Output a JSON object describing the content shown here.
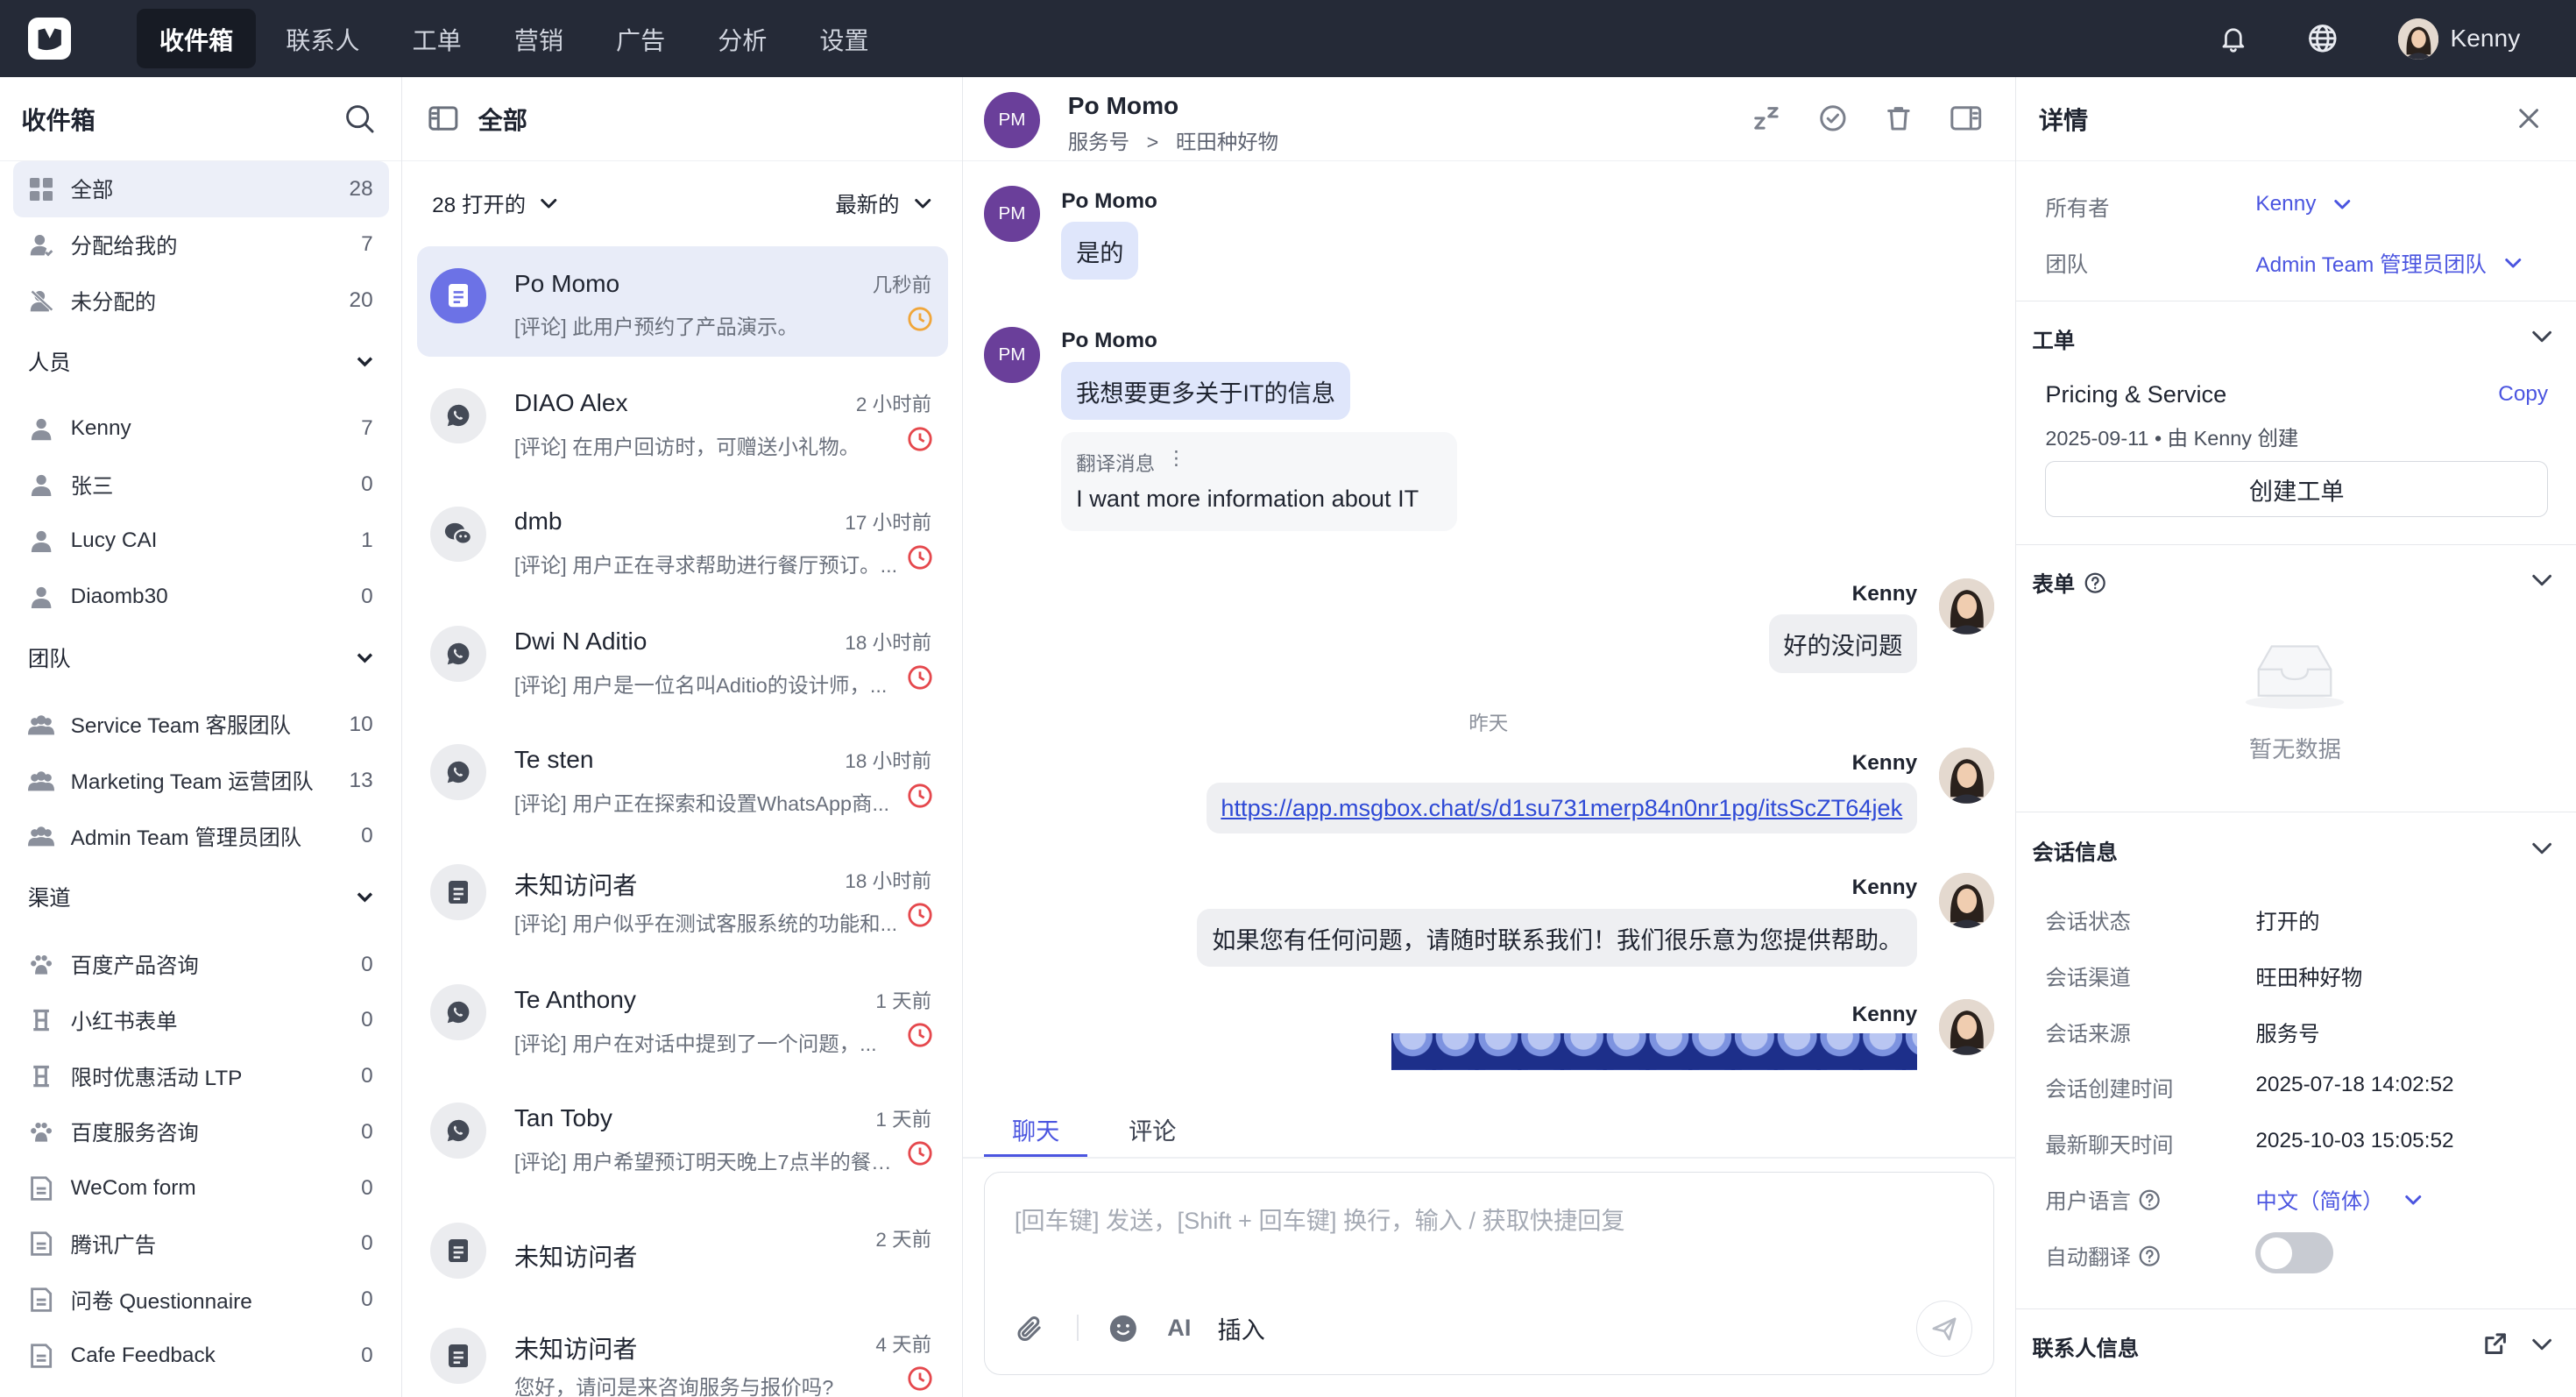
{
  "topnav": {
    "items": [
      "收件箱",
      "联系人",
      "工单",
      "营销",
      "广告",
      "分析",
      "设置"
    ],
    "user_name": "Kenny"
  },
  "sidebar": {
    "title": "收件箱",
    "inbox": [
      {
        "label": "全部",
        "count": "28"
      },
      {
        "label": "分配给我的",
        "count": "7"
      },
      {
        "label": "未分配的",
        "count": "20"
      }
    ],
    "people_title": "人员",
    "people": [
      {
        "label": "Kenny",
        "count": "7"
      },
      {
        "label": "张三",
        "count": "0"
      },
      {
        "label": "Lucy CAI",
        "count": "1"
      },
      {
        "label": "Diaomb30",
        "count": "0"
      }
    ],
    "teams_title": "团队",
    "teams": [
      {
        "label": "Service Team 客服团队",
        "count": "10"
      },
      {
        "label": "Marketing Team 运营团队",
        "count": "13"
      },
      {
        "label": "Admin Team 管理员团队",
        "count": "0"
      }
    ],
    "channels_title": "渠道",
    "channels": [
      {
        "label": "百度产品咨询",
        "count": "0",
        "icon": "baidu-icon"
      },
      {
        "label": "小红书表单",
        "count": "0",
        "icon": "form-icon"
      },
      {
        "label": "限时优惠活动 LTP",
        "count": "0",
        "icon": "form-icon"
      },
      {
        "label": "百度服务咨询",
        "count": "0",
        "icon": "baidu-icon"
      },
      {
        "label": "WeCom form",
        "count": "0",
        "icon": "doc-icon"
      },
      {
        "label": "腾讯广告",
        "count": "0",
        "icon": "doc-icon"
      },
      {
        "label": "问卷 Questionnaire",
        "count": "0",
        "icon": "doc-icon"
      },
      {
        "label": "Cafe Feedback",
        "count": "0",
        "icon": "doc-icon"
      }
    ]
  },
  "list": {
    "title": "全部",
    "filter_open": "28 打开的",
    "sort": "最新的",
    "conversations": [
      {
        "name": "Po Momo",
        "time": "几秒前",
        "preview": "[评论] 此用户预约了产品演示。",
        "icon": "doc-icon",
        "status": "pending"
      },
      {
        "name": "DIAO Alex",
        "time": "2 小时前",
        "preview": "[评论] 在用户回访时，可赠送小礼物。",
        "icon": "whatsapp-icon",
        "status": "overdue"
      },
      {
        "name": "dmb",
        "time": "17 小时前",
        "preview": "[评论] 用户正在寻求帮助进行餐厅预订。...",
        "icon": "wechat-icon",
        "status": "overdue"
      },
      {
        "name": "Dwi N Aditio",
        "time": "18 小时前",
        "preview": "[评论] 用户是一位名叫Aditio的设计师，...",
        "icon": "whatsapp-icon",
        "status": "overdue"
      },
      {
        "name": "Te sten",
        "time": "18 小时前",
        "preview": "[评论] 用户正在探索和设置WhatsApp商...",
        "icon": "whatsapp-icon",
        "status": "overdue"
      },
      {
        "name": "未知访问者",
        "time": "18 小时前",
        "preview": "[评论] 用户似乎在测试客服系统的功能和...",
        "icon": "doc-icon",
        "status": "overdue"
      },
      {
        "name": "Te Anthony",
        "time": "1 天前",
        "preview": "[评论] 用户在对话中提到了一个问题，...",
        "icon": "whatsapp-icon",
        "status": "overdue"
      },
      {
        "name": "Tan Toby",
        "time": "1 天前",
        "preview": "[评论] 用户希望预订明天晚上7点半的餐厅...",
        "icon": "whatsapp-icon",
        "status": "overdue"
      },
      {
        "name": "未知访问者",
        "time": "2 天前",
        "preview": "",
        "icon": "doc-icon",
        "status": "none"
      },
      {
        "name": "未知访问者",
        "time": "4 天前",
        "preview": "您好，请问是来咨询服务与报价吗?",
        "icon": "doc-icon",
        "status": "overdue"
      }
    ]
  },
  "chat": {
    "avatar_initials": "PM",
    "contact_name": "Po Momo",
    "channel_type": "服务号",
    "breadcrumb_sep": ">",
    "channel_name": "旺田种好物",
    "messages": {
      "m1_sender": "Po Momo",
      "m1_text": "是的",
      "m2_sender": "Po Momo",
      "m2_text": "我想要更多关于IT的信息",
      "translation_label": "翻译消息",
      "translation_menu": "⋮",
      "translation_text": "I want more information about IT",
      "m3_sender": "Kenny",
      "m3_text": "好的没问题",
      "day_separator": "昨天",
      "m4_sender": "Kenny",
      "m4_link": "https://app.msgbox.chat/s/d1su731merp84n0nr1pg/itsScZT64jek",
      "m5_sender": "Kenny",
      "m5_text": "如果您有任何问题，请随时联系我们！我们很乐意为您提供帮助。",
      "m6_sender": "Kenny"
    },
    "tabs": [
      "聊天",
      "评论"
    ],
    "composer_placeholder": "[回车键] 发送，[Shift + 回车键] 换行，输入 / 获取快捷回复",
    "ai_label": "AI",
    "insert_label": "插入"
  },
  "details": {
    "title": "详情",
    "owner_label": "所有者",
    "owner_value": "Kenny",
    "team_label": "团队",
    "team_value": "Admin Team 管理员团队",
    "ticket_section": "工单",
    "ticket_title": "Pricing & Service",
    "ticket_copy": "Copy",
    "ticket_meta": "2025-09-11 • 由 Kenny 创建",
    "create_ticket_button": "创建工单",
    "form_section": "表单",
    "empty_text": "暂无数据",
    "session_section": "会话信息",
    "session": [
      {
        "label": "会话状态",
        "value": "打开的"
      },
      {
        "label": "会话渠道",
        "value": "旺田种好物"
      },
      {
        "label": "会话来源",
        "value": "服务号"
      },
      {
        "label": "会话创建时间",
        "value": "2025-07-18 14:02:52"
      },
      {
        "label": "最新聊天时间",
        "value": "2025-10-03 15:05:52"
      }
    ],
    "language_label": "用户语言",
    "language_value": "中文（简体）",
    "auto_translate_label": "自动翻译",
    "auto_translate_on": false,
    "contact_section": "联系人信息"
  },
  "colors": {
    "accent": "#4b55e0",
    "topbar": "#252a37",
    "avatar_pm": "#6a3f9a",
    "overdue": "#e5484d",
    "pending": "#f0a63a"
  }
}
